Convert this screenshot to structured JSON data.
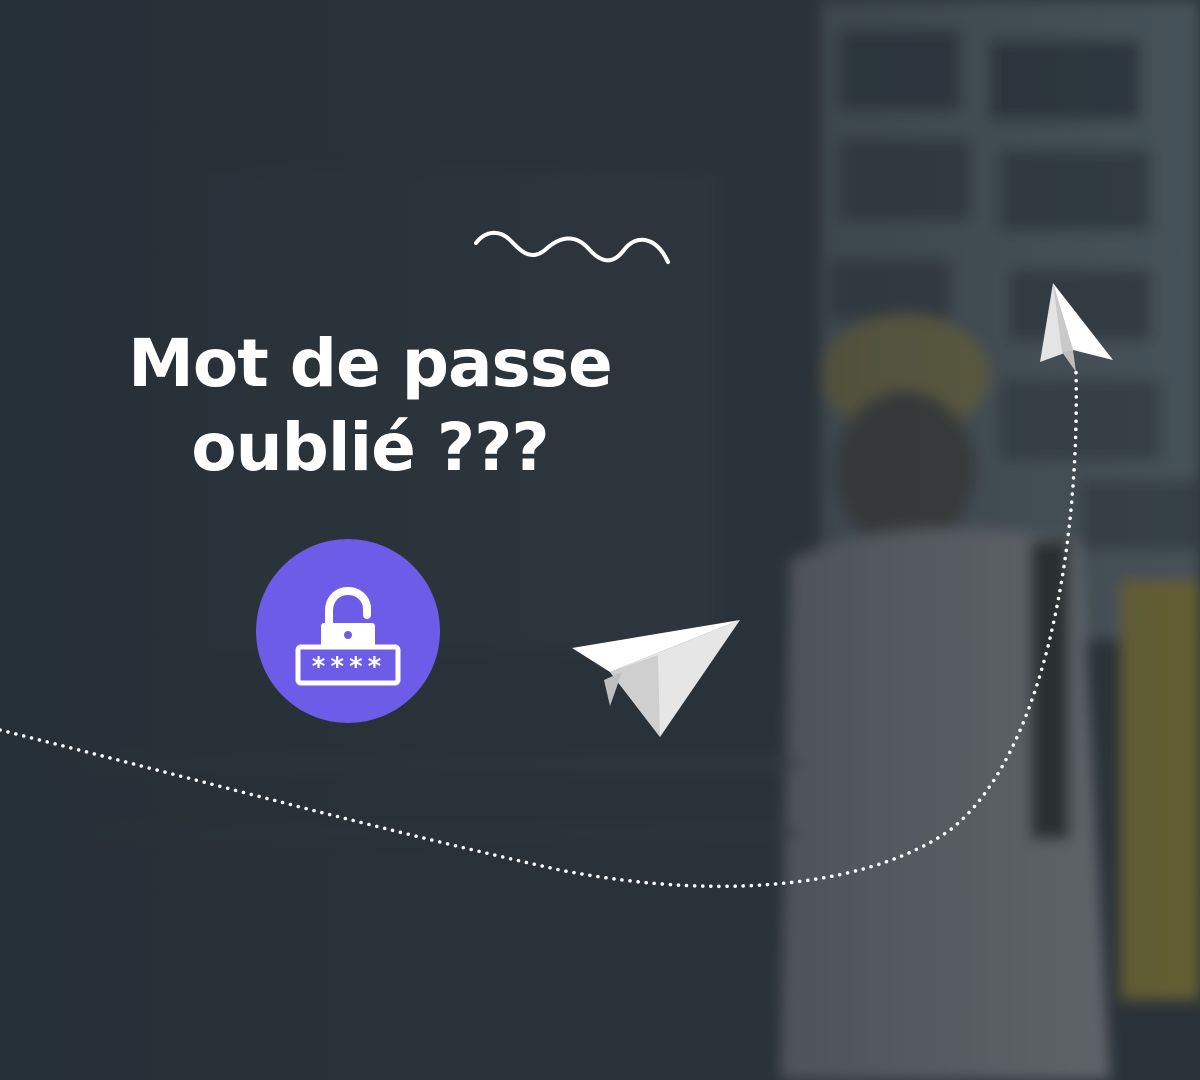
{
  "headline": {
    "line1": "Mot de passe",
    "line2": "oublié ???"
  },
  "badge": {
    "icon": "unlocked-padlock-password-icon",
    "password_mask": "****",
    "color": "#6d5ce8"
  },
  "colors": {
    "background": "#2a3239",
    "text": "#ffffff",
    "accent": "#6d5ce8"
  },
  "icons": [
    "squiggle-line-icon",
    "paper-plane-icon",
    "dotted-path-arrow"
  ]
}
